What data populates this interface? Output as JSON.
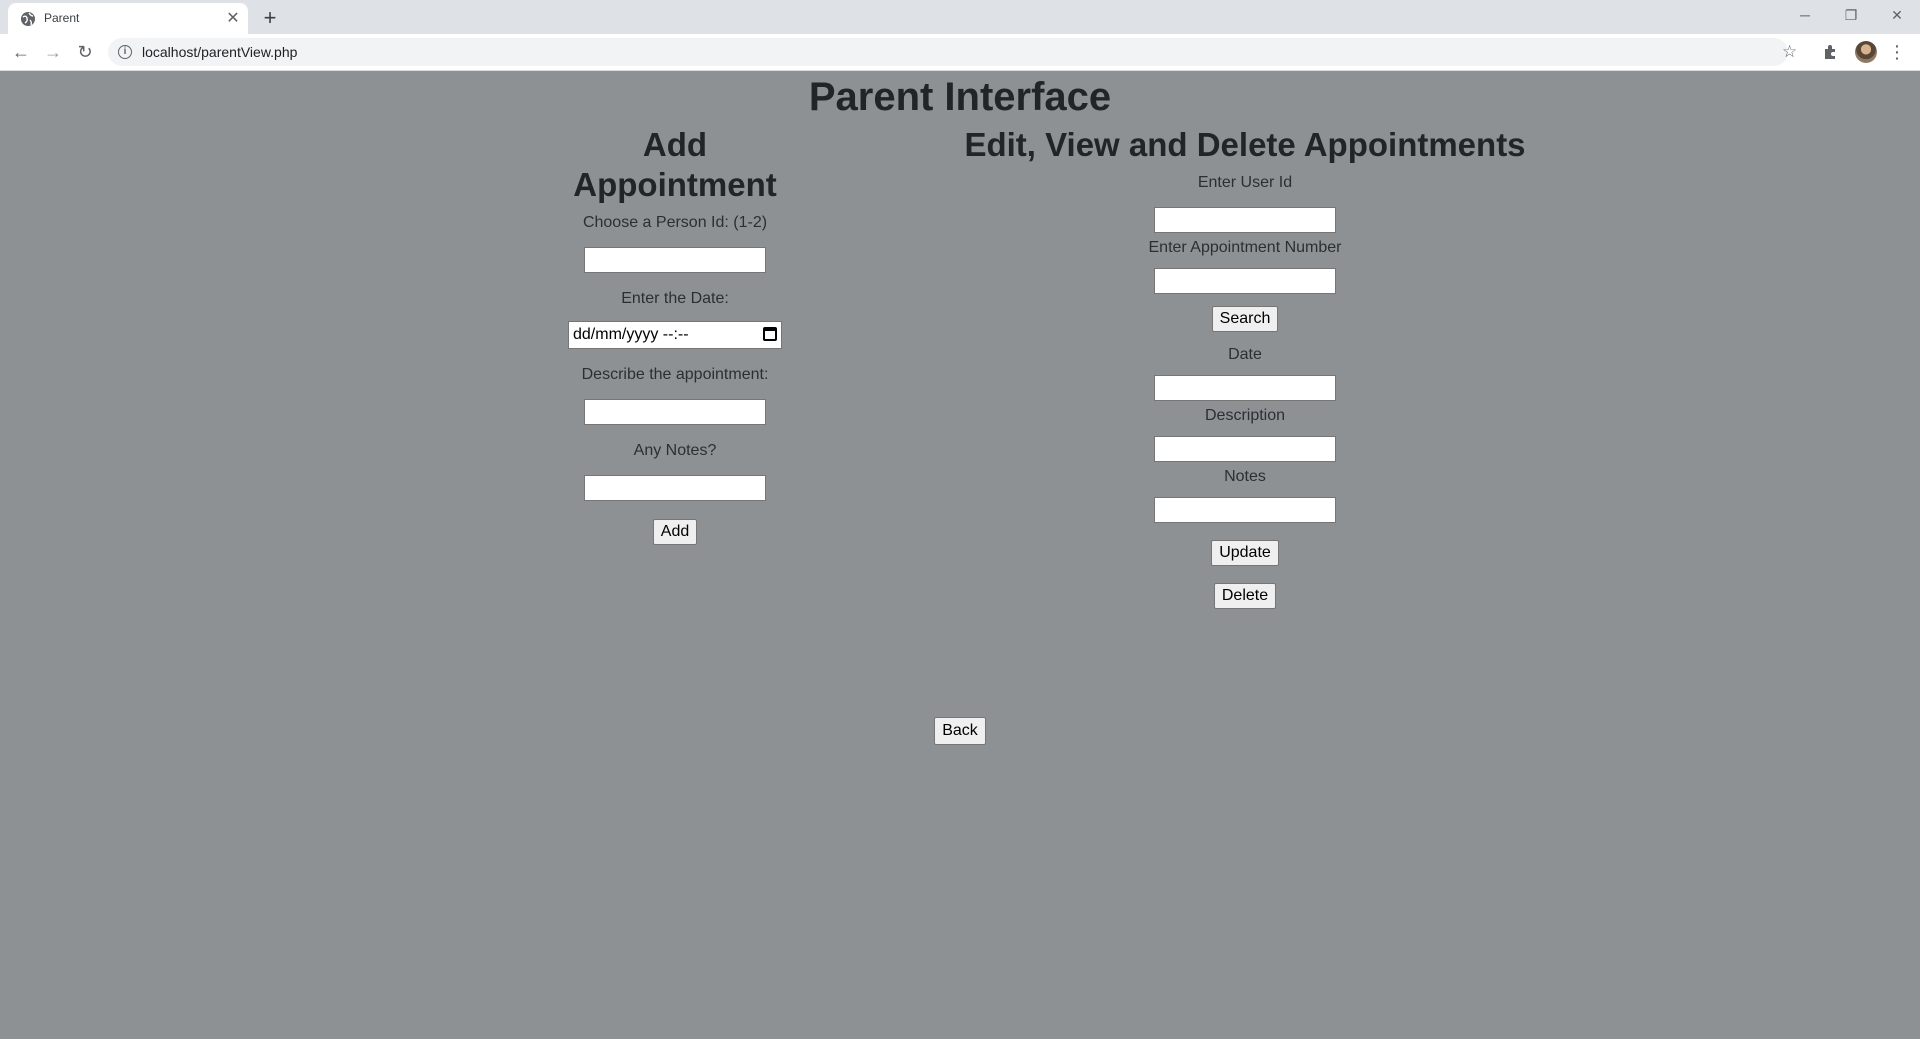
{
  "browser": {
    "tab_title": "Parent",
    "tab_close": "✕",
    "new_tab": "+",
    "url": "localhost/parentView.php",
    "window_controls": [
      "─",
      "❐",
      "✕"
    ]
  },
  "page": {
    "title": "Parent Interface",
    "add": {
      "heading": "Add Appointment",
      "person_label": "Choose a Person Id: (1-2)",
      "date_label": "Enter the Date:",
      "date_placeholder": "dd/mm/yyyy --:--",
      "describe_label": "Describe the appointment:",
      "notes_label": "Any Notes?",
      "add_button": "Add"
    },
    "edit": {
      "heading": "Edit, View and Delete Appointments",
      "user_id_label": "Enter User Id",
      "appointment_number_label": "Enter Appointment Number",
      "search_button": "Search",
      "date_label": "Date",
      "description_label": "Description",
      "notes_label": "Notes",
      "update_button": "Update",
      "delete_button": "Delete"
    },
    "back_button": "Back"
  }
}
